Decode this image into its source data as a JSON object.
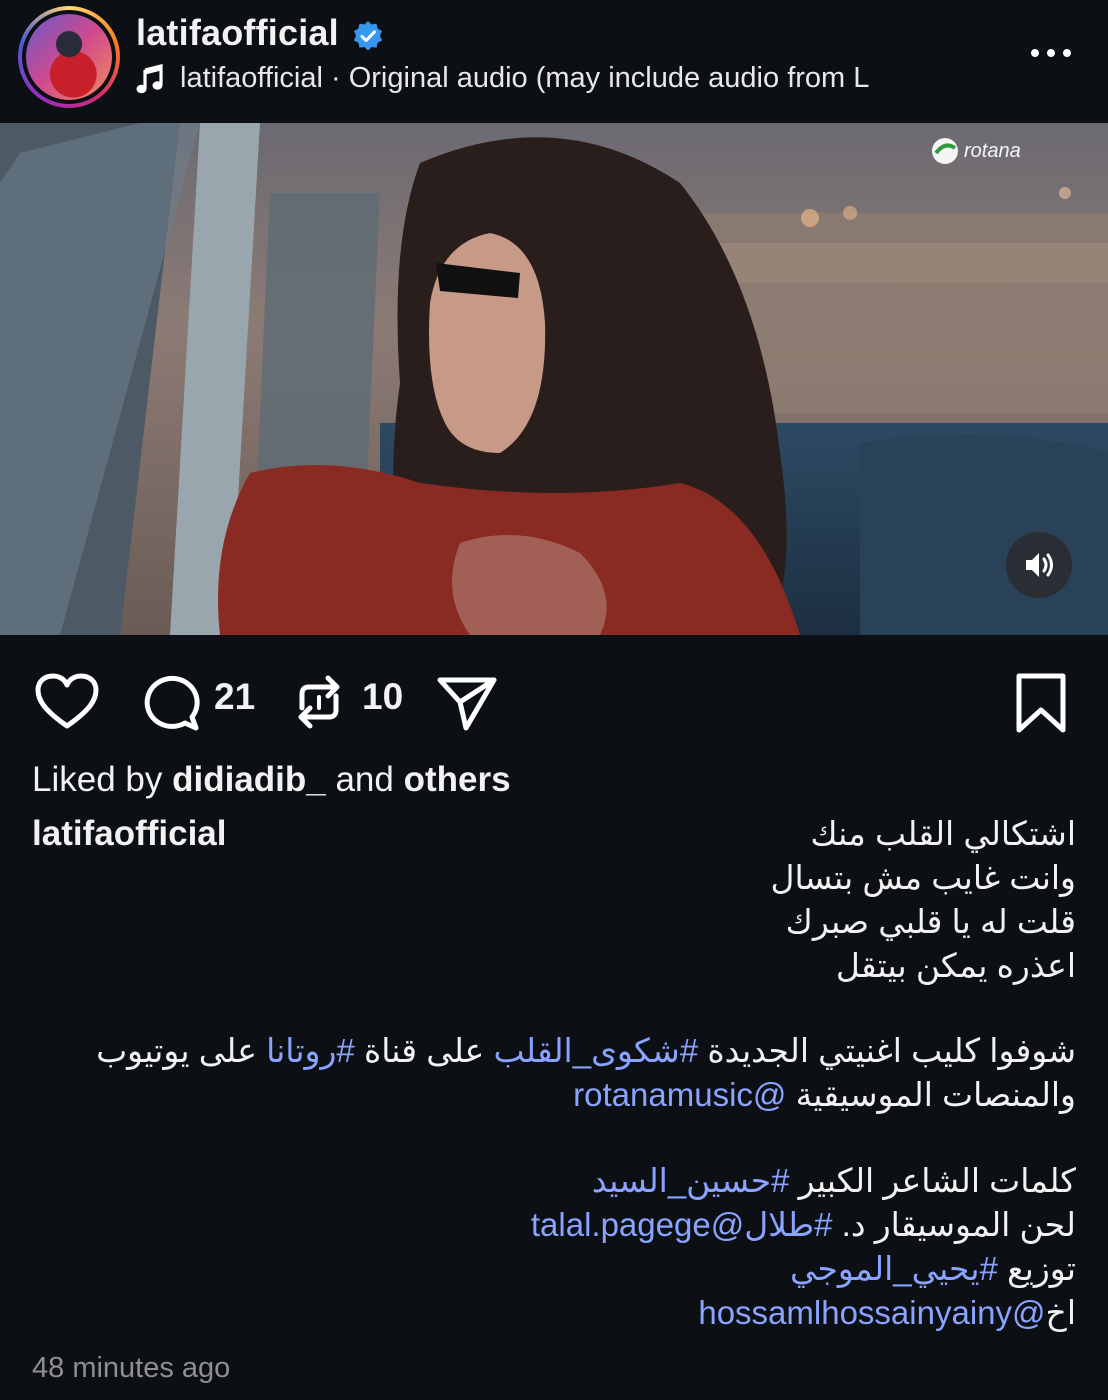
{
  "header": {
    "username": "latifaofficial",
    "audio_owner": "latifaofficial",
    "audio_separator": " · ",
    "audio_text": "Original audio  (may include audio from L"
  },
  "actions": {
    "comments_count": "21",
    "reposts_count": "10"
  },
  "likes": {
    "prefix": "Liked by ",
    "user": "didiadib_",
    "middle": " and ",
    "others": "others"
  },
  "caption": {
    "username": "latifaofficial",
    "line1": "اشتكالي القلب منك",
    "line2": "وانت غايب مش بتسال",
    "line3": "قلت له يا قلبي صبرك",
    "line4": "اعذره يمكن بيتقل",
    "line5_a": "شوفوا كليب اغنيتي الجديدة ",
    "line5_tag1": "#شكوى_القلب",
    "line5_b": " على قناة ",
    "line5_tag2": "#روتانا",
    "line5_c": " على يوتيوب",
    "line6_a": "والمنصات الموسيقية ",
    "line6_mention": "@rotanamusic",
    "line7_a": "كلمات الشاعر الكبير ",
    "line7_tag": "#حسين_السيد",
    "line8_a": "لحن الموسيقار د. ",
    "line8_tag": "#طلال",
    "line8_mention": "@talal.pagege",
    "line9_a": "توزيع ",
    "line9_tag": "#يحيي_الموجي",
    "line10_a": "اخ",
    "line10_mention": "@hossamlhossainyainy"
  },
  "timestamp": "48 minutes ago",
  "colors": {
    "background": "#0c0f14",
    "link": "#8aa3ff",
    "verified": "#3897f0"
  }
}
